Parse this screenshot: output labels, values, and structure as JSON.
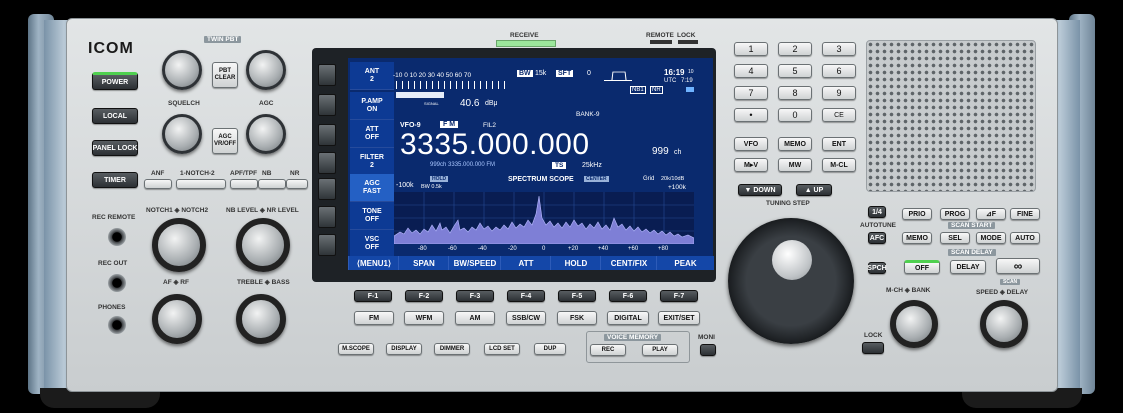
{
  "brand": "ICOM",
  "top": {
    "receive": "RECEIVE",
    "remote": "REMOTE",
    "lock": "LOCK"
  },
  "left_buttons": [
    "POWER",
    "LOCAL",
    "PANEL LOCK",
    "TIMER"
  ],
  "twin_pbt": "TWIN PBT",
  "pbt_clear": "PBT\nCLEAR",
  "agc_vr": "AGC\nVR/OFF",
  "labels": {
    "squelch": "SQUELCH",
    "agc": "AGC",
    "rec_remote": "REC REMOTE",
    "rec_out": "REC OUT",
    "phones": "PHONES",
    "notch": "NOTCH1 ◈ NOTCH2",
    "nb_nr": "NB LEVEL ◈ NR LEVEL",
    "af_rf": "AF ◈ RF",
    "treble_bass": "TREBLE ◈ BASS",
    "tuning_step": "TUNING STEP",
    "mch_bank": "M-CH ◈ BANK",
    "speed_delay": "SPEED ◈ DELAY",
    "scan": "SCAN",
    "scan_start": "SCAN START",
    "scan_delay": "SCAN DELAY",
    "autotune": "AUTOTUNE",
    "voice_memory": "VOICE MEMORY",
    "moni": "MONI",
    "lock": "LOCK"
  },
  "filter_row": [
    "ANF",
    "1-NOTCH-2",
    "APF/TPF",
    "NB",
    "NR"
  ],
  "display": {
    "menu_side": [
      [
        "ANT",
        "2"
      ],
      [
        "P.AMP",
        "ON"
      ],
      [
        "ATT",
        "OFF"
      ],
      [
        "FILTER",
        "2"
      ],
      [
        "AGC",
        "FAST"
      ],
      [
        "TONE",
        "OFF"
      ],
      [
        "VSC",
        "OFF"
      ]
    ],
    "scale": "-10 0 10 20 30 40 50 60 70",
    "signal": "SIGNAL",
    "level": "40.6",
    "level_unit": "dBμ",
    "bw": "BW",
    "bw_val": "15k",
    "sft": "SFT",
    "sft_val": "0",
    "nb1": "NB1",
    "nr": "NR",
    "time": "16:19",
    "time_sec": "10",
    "utc": "UTC",
    "utc_time": "7:19",
    "bank": "BANK-9",
    "vfo": "VFO-9",
    "mode": "F M",
    "fil": "FIL2",
    "freq": "3335.000.000",
    "ch": "999",
    "ch_unit": "ch",
    "sub_info": "999ch   3335.000.000  FM",
    "ts": "TS",
    "ts_val": "25kHz",
    "scope_left": "-100k",
    "scope_bw": "BW 0.5k",
    "hold": "HOLD",
    "scope_title": "SPECTRUM SCOPE",
    "center": "CENTER",
    "grid": "Grid",
    "grid_val": "20k/10dB",
    "scope_right": "+100k",
    "scope_ticks": [
      "-80",
      "-60",
      "-40",
      "-20",
      "0",
      "+20",
      "+40",
      "+60",
      "+80"
    ],
    "softkeys": [
      "⟨MENU1⟩",
      "SPAN",
      "BW/SPEED",
      "ATT",
      "HOLD",
      "CENT/FIX",
      "PEAK"
    ]
  },
  "fkeys": [
    "F-1",
    "F-2",
    "F-3",
    "F-4",
    "F-5",
    "F-6",
    "F-7"
  ],
  "modes": [
    "FM",
    "WFM",
    "AM",
    "SSB/CW",
    "FSK",
    "DIGITAL",
    "EXIT/SET"
  ],
  "bottom": [
    "M.SCOPE",
    "DISPLAY",
    "DIMMER",
    "LCD SET",
    "DUP"
  ],
  "voice": [
    "REC",
    "PLAY"
  ],
  "keypad": [
    "1",
    "2",
    "3",
    "4",
    "5",
    "6",
    "7",
    "8",
    "9",
    "•",
    "0",
    "CE"
  ],
  "vfo_keys": [
    "VFO",
    "MEMO",
    "ENT",
    "M▸V",
    "MW",
    "M-CL"
  ],
  "updown": [
    "▼ DOWN",
    "▲ UP"
  ],
  "right_keys": {
    "one_four": "1/4",
    "afc": "AFC",
    "spch": "SPCH",
    "row1": [
      "PRIO",
      "PROG",
      "⊿F",
      "FINE"
    ],
    "row2": [
      "MEMO",
      "SEL",
      "MODE",
      "AUTO"
    ],
    "row3": [
      "OFF",
      "DELAY",
      "∞"
    ]
  }
}
